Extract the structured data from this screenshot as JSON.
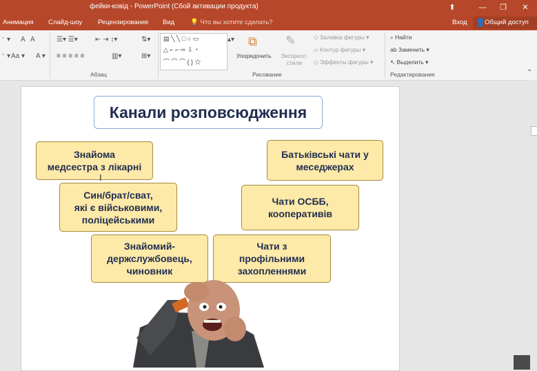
{
  "app": {
    "window_title": "фейки-ковід - PowerPoint (Сбой активации продукта)",
    "window_buttons": [
      "⬆",
      "—",
      "❐",
      "✕"
    ]
  },
  "tabs": {
    "items": [
      "Анимация",
      "Слайд-шоу",
      "Рецензирование",
      "Вид"
    ],
    "tell_me": "Что вы хотите сделать?",
    "sign_in": "Вход",
    "share": "Общий доступ"
  },
  "ribbon": {
    "paragraph_group": "Абзац",
    "drawing_group": "Рисование",
    "editing_group": "Редактирование",
    "arrange": "Упорядочить",
    "quick_styles": "Экспресс-\nстили",
    "shape_fill": "Заливка фигуры",
    "shape_outline": "Контур фигуры",
    "shape_effects": "Эффекты фигуры",
    "find": "Найти",
    "replace": "Заменить",
    "select": "Выделить"
  },
  "slide": {
    "title": "Канали розповсюдження",
    "boxes": [
      "Знайома\nмедсестра з лікарні",
      "Батьківські чати у\nмеседжерах",
      "Син/брат/сват,\nякі є військовими,\nполіцейськими",
      "Чати ОСББ,\nкооперативів",
      "Знайомий-\nдержслужбовець,\nчиновник",
      "Чати з\nпрофільними\nзахопленнями"
    ]
  },
  "colors": {
    "accent": "#b7472a",
    "box_fill": "#fde9a8",
    "box_border": "#a68a3c",
    "title_text": "#1f2d4f"
  }
}
